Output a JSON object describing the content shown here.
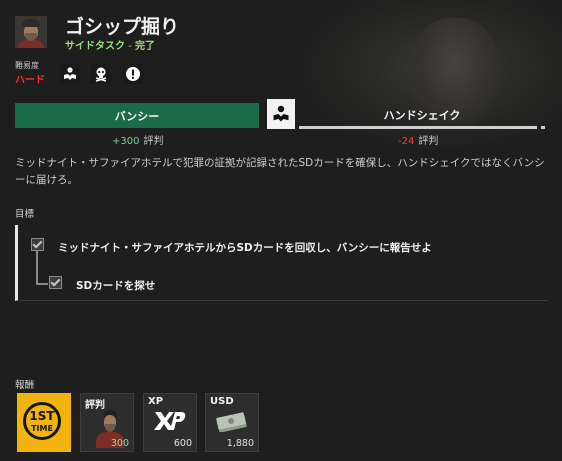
{
  "mission": {
    "title": "ゴシップ掘り",
    "type": "サイドタスク",
    "separator": "-",
    "status": "完了",
    "difficulty_label": "難易度",
    "difficulty_value": "ハード",
    "modifier_icons": [
      "handshake-icon",
      "skull-icon",
      "skull-icon",
      "alert-icon"
    ]
  },
  "choices": {
    "left_label": "バンシー",
    "right_label": "ハンドシェイク",
    "left_rep_value": "+300",
    "left_rep_label": "評判",
    "right_rep_value": "-24",
    "right_rep_label": "評判",
    "center_icon": "handshake-icon"
  },
  "description": "ミッドナイト・サファイアホテルで犯罪の証拠が記録されたSDカードを確保し、ハンドシェイクではなくバンシーに届けろ。",
  "objectives": {
    "heading": "目標",
    "items": [
      {
        "text": "ミッドナイト・サファイアホテルからSDカードを回収し、バンシーに報告せよ",
        "checked": true
      },
      {
        "text": "SDカードを探せ",
        "checked": true
      }
    ]
  },
  "rewards": {
    "heading": "報酬",
    "items": [
      {
        "label": "1ST",
        "sublabel": "TIME",
        "icon": "first-time-icon"
      },
      {
        "label": "評判",
        "amount": "300",
        "icon": "portrait-icon"
      },
      {
        "label": "XP",
        "amount": "600",
        "icon": "xp-icon"
      },
      {
        "label": "USD",
        "amount": "1,880",
        "icon": "cash-icon"
      }
    ]
  },
  "colors": {
    "choice_selected": "#1b6b46",
    "completed_green": "#9be07a",
    "difficulty_red": "#ff3030",
    "reward_first_time": "#f0b40d"
  }
}
